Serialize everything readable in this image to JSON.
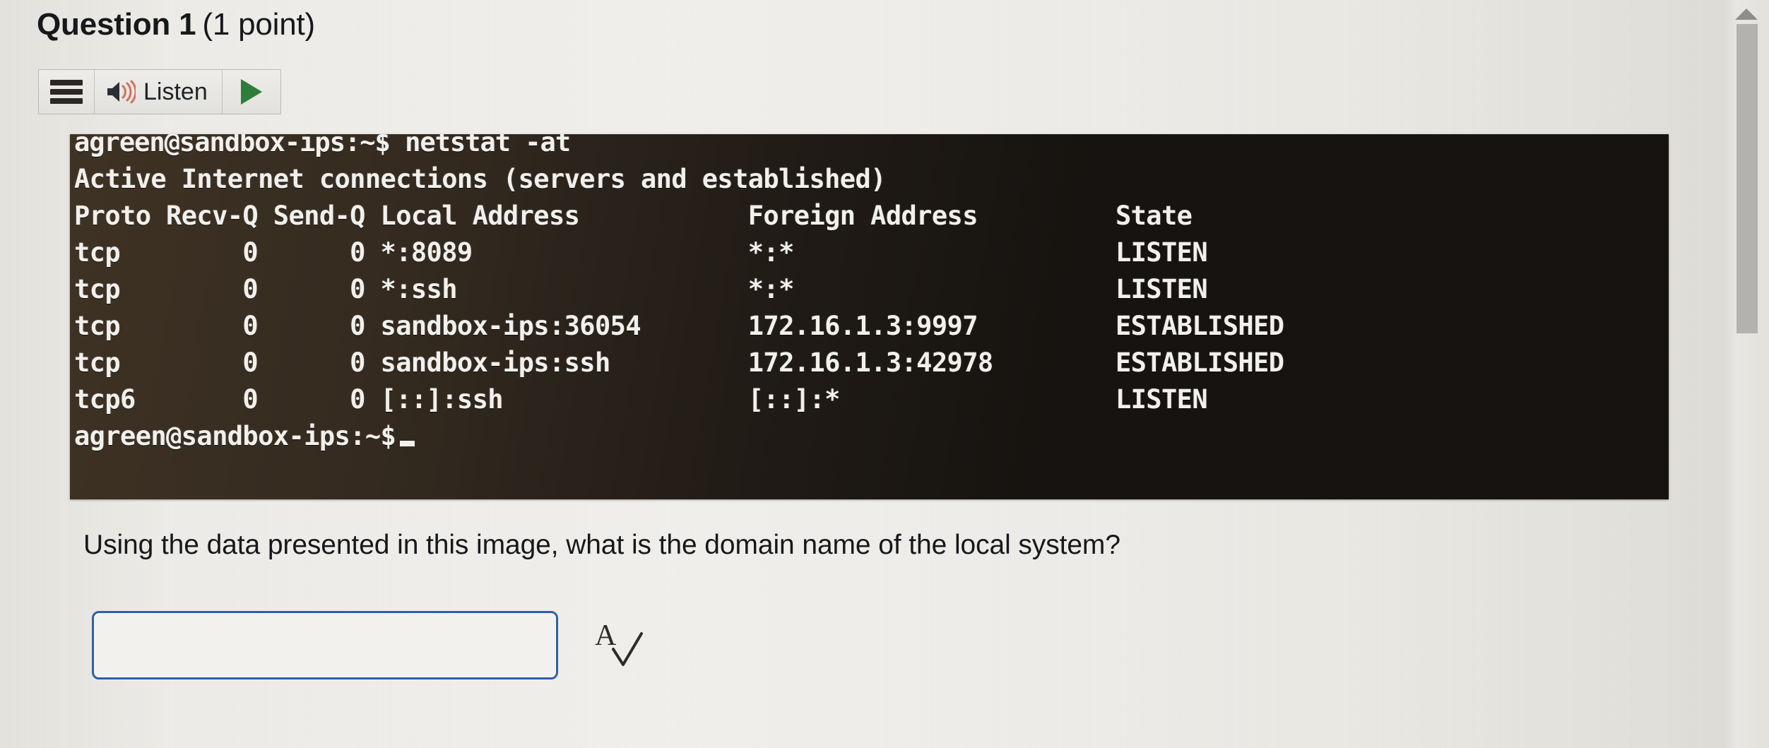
{
  "heading": {
    "question_label": "Question 1",
    "points_label": "(1 point)"
  },
  "toolbar": {
    "menu_icon": "hamburger-menu-icon",
    "speaker_icon": "speaker-sound-icon",
    "listen_label": "Listen",
    "play_icon": "play-triangle-icon"
  },
  "terminal": {
    "background_color": "#161310",
    "text_color": "#f2f0ec",
    "lines": [
      "agreen@sandbox-ips:~$ netstat -at",
      "Active Internet connections (servers and established)",
      "Proto Recv-Q Send-Q Local Address           Foreign Address         State",
      "tcp        0      0 *:8089                  *:*                     LISTEN",
      "tcp        0      0 *:ssh                   *:*                     LISTEN",
      "tcp        0      0 sandbox-ips:36054       172.16.1.3:9997         ESTABLISHED",
      "tcp        0      0 sandbox-ips:ssh         172.16.1.3:42978        ESTABLISHED",
      "tcp6       0      0 [::]:ssh                [::]:*                  LISTEN"
    ],
    "prompt_line": "agreen@sandbox-ips:~$",
    "command": "netstat -at",
    "columns": [
      "Proto",
      "Recv-Q",
      "Send-Q",
      "Local Address",
      "Foreign Address",
      "State"
    ],
    "rows": [
      {
        "proto": "tcp",
        "recv_q": "0",
        "send_q": "0",
        "local_address": "*:8089",
        "foreign_address": "*:*",
        "state": "LISTEN"
      },
      {
        "proto": "tcp",
        "recv_q": "0",
        "send_q": "0",
        "local_address": "*:ssh",
        "foreign_address": "*:*",
        "state": "LISTEN"
      },
      {
        "proto": "tcp",
        "recv_q": "0",
        "send_q": "0",
        "local_address": "sandbox-ips:36054",
        "foreign_address": "172.16.1.3:9997",
        "state": "ESTABLISHED"
      },
      {
        "proto": "tcp",
        "recv_q": "0",
        "send_q": "0",
        "local_address": "sandbox-ips:ssh",
        "foreign_address": "172.16.1.3:42978",
        "state": "ESTABLISHED"
      },
      {
        "proto": "tcp6",
        "recv_q": "0",
        "send_q": "0",
        "local_address": "[::]:ssh",
        "foreign_address": "[::]:*",
        "state": "LISTEN"
      }
    ]
  },
  "question": {
    "prompt": "Using the data presented in this image, what is the domain name of the local system?"
  },
  "answer": {
    "value": "",
    "placeholder": "",
    "border_color": "#2f5fa8",
    "spellcheck_icon": "spellcheck-a-check-icon"
  },
  "scrollbar": {
    "up_arrow_icon": "scroll-up-arrow-icon",
    "thumb_color": "#b3b2af"
  }
}
